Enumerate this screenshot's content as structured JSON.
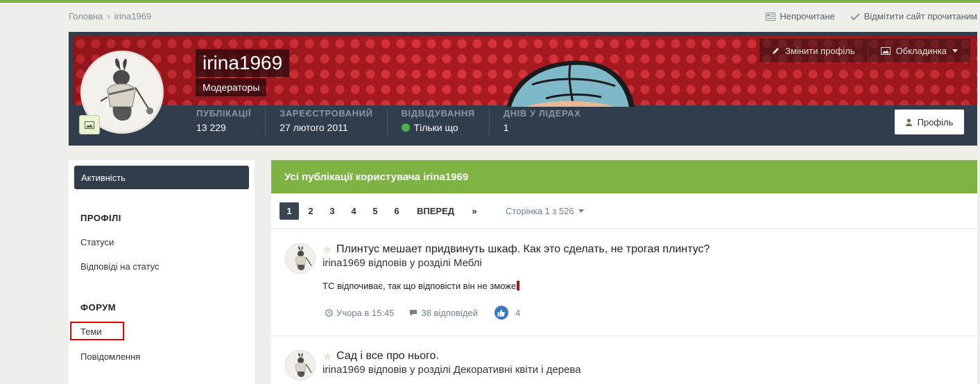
{
  "breadcrumb": {
    "home": "Головна",
    "current": "irina1969"
  },
  "top_actions": {
    "unread": "Непрочитане",
    "mark_read": "Відмітити сайт прочитаним"
  },
  "cover": {
    "edit_profile": "Змінити профіль",
    "cover_photo": "Обкладинка",
    "username": "irina1969",
    "group": "Модераторы",
    "stats": [
      {
        "label": "Публікації",
        "value": "13 229"
      },
      {
        "label": "Зареєстрований",
        "value": "27 лютого 2011"
      },
      {
        "label": "Відвідування",
        "value": "Тільки що"
      },
      {
        "label": "Днів у лідерах",
        "value": "1"
      }
    ],
    "profile_button": "Профіль"
  },
  "sidebar": {
    "active": "Активність",
    "section_profiles": "ПРОФІЛІ",
    "statuses": "Статуси",
    "status_replies": "Відповіді на статус",
    "section_forum": "ФОРУМ",
    "topics": "Теми",
    "posts": "Повідомлення"
  },
  "main": {
    "heading": "Усі публікації користувача irina1969",
    "pager": {
      "pages": [
        "1",
        "2",
        "3",
        "4",
        "5",
        "6"
      ],
      "current": "1",
      "next": "ВПЕРЕД",
      "last": "»",
      "info": "Сторінка 1 з 526"
    },
    "posts": [
      {
        "title": "Плинтус мешает придвинуть шкаф. Как это сделать, не трогая плинтус?",
        "subtitle": "irina1969 відповів у розділі Меблі",
        "body": "ТС відпочиває, так що відповісти він не зможе",
        "time": "Учора в 15:45",
        "replies": "38 відповідей",
        "likes": "4"
      },
      {
        "title": "Сад і все про нього.",
        "subtitle": "irina1969 відповів у розділі Декоративні квіти і дерева"
      }
    ]
  },
  "colors": {
    "accent_green": "#7cb342",
    "dark_bar": "#2f3d4d",
    "cover_red": "#a91a21",
    "online": "#4caf50",
    "highlight": "#ee0000"
  }
}
